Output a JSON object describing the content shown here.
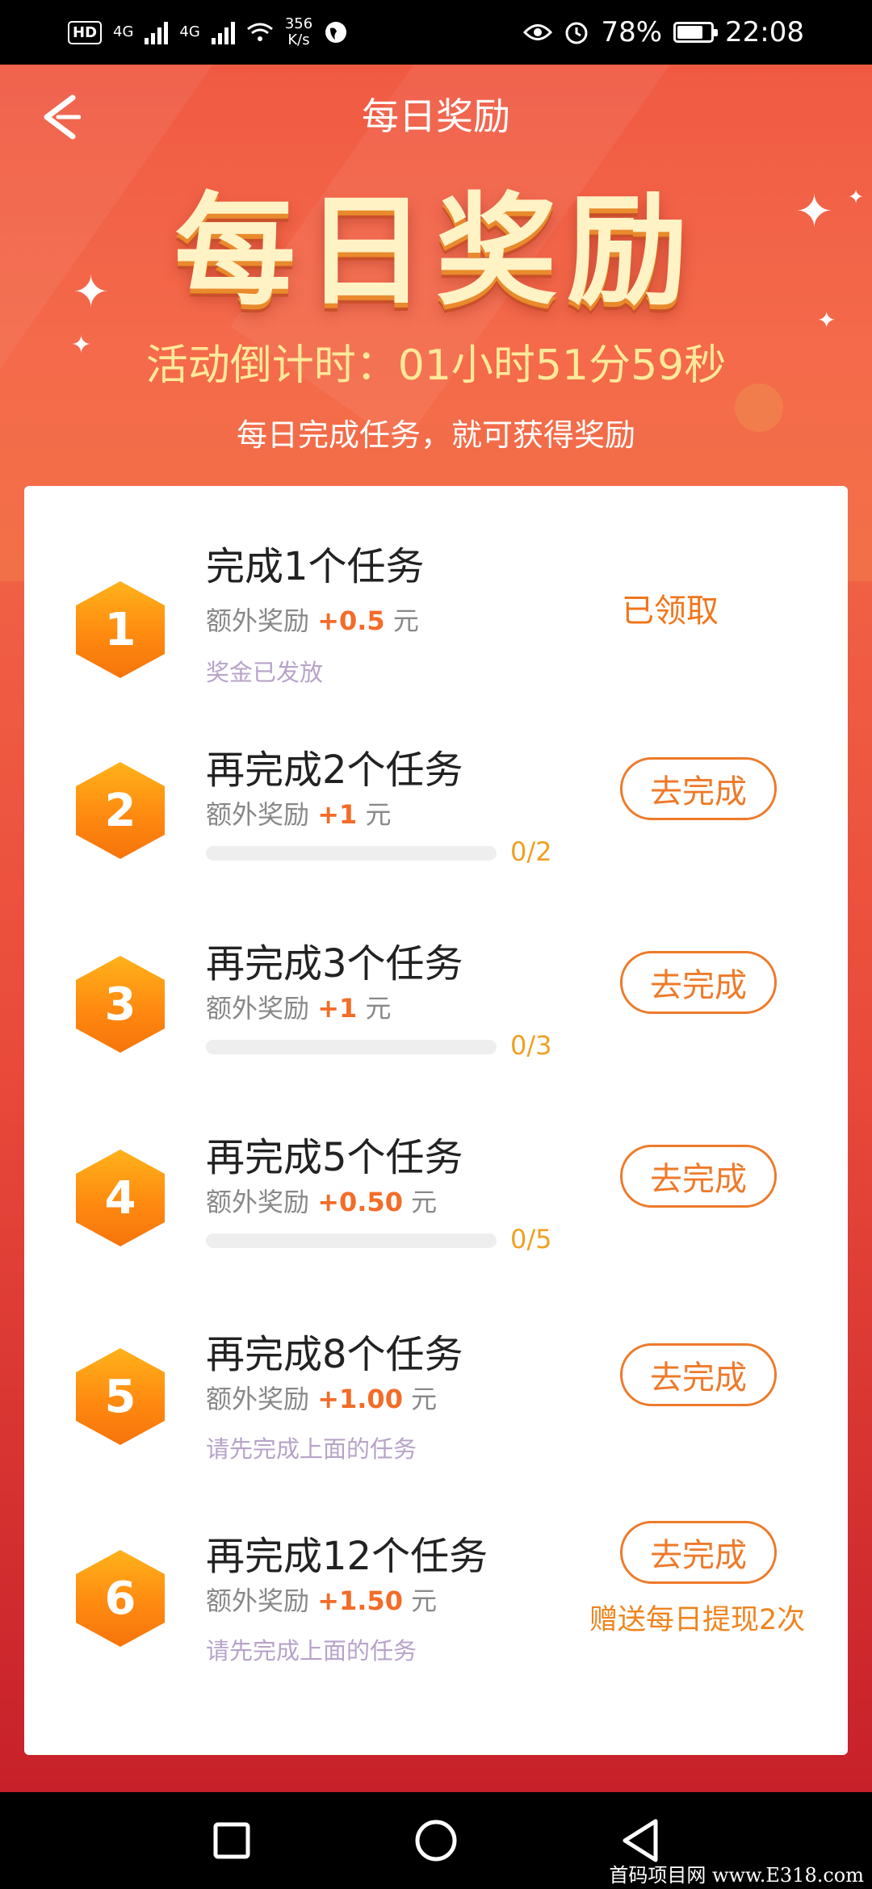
{
  "status_bar": {
    "hd": "HD",
    "net1": "4G",
    "net2": "4G",
    "speed_value": "356",
    "speed_unit": "K/s",
    "battery": "78%",
    "battery_level": 0.78,
    "time": "22:08"
  },
  "header": {
    "title": "每日奖励",
    "banner": "每日奖励",
    "countdown": "活动倒计时：01小时51分59秒",
    "subtitle": "每日完成任务，就可获得奖励"
  },
  "tasks": [
    {
      "num": "1",
      "title": "完成1个任务",
      "reward_prefix": "额外奖励",
      "reward_amount": "+0.5",
      "reward_unit": "元",
      "note": "奖金已发放",
      "status": "已领取"
    },
    {
      "num": "2",
      "title": "再完成2个任务",
      "reward_prefix": "额外奖励",
      "reward_amount": "+1",
      "reward_unit": "元",
      "progress": "0/2",
      "progress_fraction": 0,
      "action": "去完成"
    },
    {
      "num": "3",
      "title": "再完成3个任务",
      "reward_prefix": "额外奖励",
      "reward_amount": "+1",
      "reward_unit": "元",
      "progress": "0/3",
      "progress_fraction": 0,
      "action": "去完成"
    },
    {
      "num": "4",
      "title": "再完成5个任务",
      "reward_prefix": "额外奖励",
      "reward_amount": "+0.50",
      "reward_unit": "元",
      "progress": "0/5",
      "progress_fraction": 0,
      "action": "去完成"
    },
    {
      "num": "5",
      "title": "再完成8个任务",
      "reward_prefix": "额外奖励",
      "reward_amount": "+1.00",
      "reward_unit": "元",
      "note": "请先完成上面的任务",
      "action": "去完成"
    },
    {
      "num": "6",
      "title": "再完成12个任务",
      "reward_prefix": "额外奖励",
      "reward_amount": "+1.50",
      "reward_unit": "元",
      "note": "请先完成上面的任务",
      "action": "去完成",
      "bonus": "赠送每日提现2次"
    }
  ],
  "nav": {
    "icons": [
      "recent-apps-icon",
      "home-icon",
      "back-icon"
    ]
  },
  "watermark": "首码项目网 www.E318.com",
  "colors": {
    "accent": "#f36c28",
    "hero": "#f05a43",
    "button_border": "#ee7a2a",
    "hex_badge": "#ff8a10"
  }
}
